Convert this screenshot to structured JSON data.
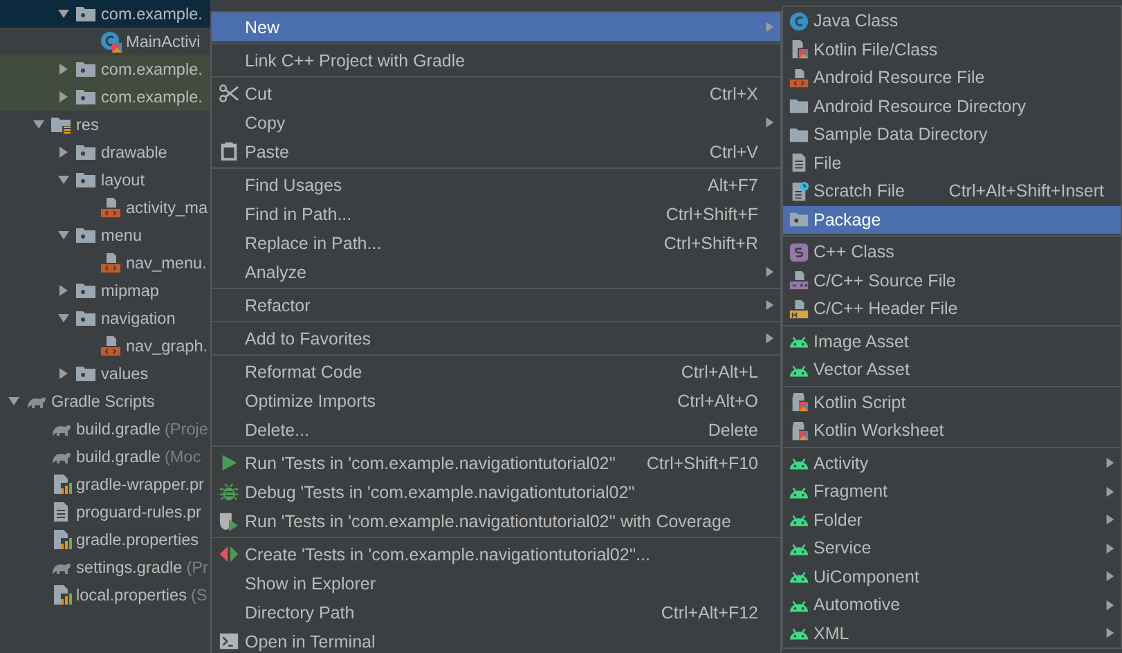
{
  "tree": {
    "items": [
      {
        "children": [
          {
            "children": [
              {
                "label": "com.example.",
                "kind": "package",
                "expanded": true,
                "selected": true,
                "tinted": false,
                "children": [
                  {
                    "label": "MainActivi",
                    "kind": "kotlin-class",
                    "selected": false,
                    "tinted": false
                  }
                ]
              },
              {
                "label": "com.example.",
                "kind": "package",
                "expanded": false,
                "selected": false,
                "tinted": true
              },
              {
                "label": "com.example.",
                "kind": "package",
                "expanded": false,
                "selected": false,
                "tinted": true
              }
            ]
          },
          {
            "label": "res",
            "kind": "res-folder",
            "expanded": true,
            "selected": false,
            "tinted": false,
            "children": [
              {
                "label": "drawable",
                "kind": "package",
                "expanded": false,
                "selected": false,
                "tinted": false
              },
              {
                "label": "layout",
                "kind": "package",
                "expanded": true,
                "selected": false,
                "tinted": false,
                "children": [
                  {
                    "label": "activity_ma",
                    "kind": "resource-file",
                    "selected": false,
                    "tinted": false
                  }
                ]
              },
              {
                "label": "menu",
                "kind": "package",
                "expanded": true,
                "selected": false,
                "tinted": false,
                "children": [
                  {
                    "label": "nav_menu.",
                    "kind": "resource-file",
                    "selected": false,
                    "tinted": false
                  }
                ]
              },
              {
                "label": "mipmap",
                "kind": "package",
                "expanded": false,
                "selected": false,
                "tinted": false
              },
              {
                "label": "navigation",
                "kind": "package",
                "expanded": true,
                "selected": false,
                "tinted": false,
                "children": [
                  {
                    "label": "nav_graph.",
                    "kind": "resource-file",
                    "selected": false,
                    "tinted": false
                  }
                ]
              },
              {
                "label": "values",
                "kind": "package",
                "expanded": false,
                "selected": false,
                "tinted": false
              }
            ]
          }
        ]
      },
      {
        "label": "Gradle Scripts",
        "kind": "gradle",
        "expanded": true,
        "selected": false,
        "tinted": false,
        "children": [
          {
            "label": "build.gradle",
            "note": "(Proje",
            "kind": "gradle",
            "selected": false,
            "tinted": false
          },
          {
            "label": "build.gradle",
            "note": "(Moc",
            "kind": "gradle",
            "selected": false,
            "tinted": false
          },
          {
            "label": "gradle-wrapper.pr",
            "kind": "properties",
            "selected": false,
            "tinted": false
          },
          {
            "label": "proguard-rules.pr",
            "kind": "text-file",
            "selected": false,
            "tinted": false
          },
          {
            "label": "gradle.properties",
            "kind": "properties",
            "selected": false,
            "tinted": false
          },
          {
            "label": "settings.gradle",
            "note": "(Pr",
            "kind": "gradle",
            "selected": false,
            "tinted": false
          },
          {
            "label": "local.properties",
            "note": "(S",
            "kind": "properties",
            "selected": false,
            "tinted": false
          }
        ]
      }
    ]
  },
  "context_menu": {
    "groups": [
      [
        {
          "label": "New",
          "submenu": true,
          "selected": true
        }
      ],
      [
        {
          "label": "Link C++ Project with Gradle",
          "submenu": false,
          "selected": false
        }
      ],
      [
        {
          "label": "Cut",
          "kind": "scissors",
          "shortcut": "Ctrl+X",
          "submenu": false,
          "selected": false
        },
        {
          "label": "Copy",
          "submenu": true,
          "selected": false
        },
        {
          "label": "Paste",
          "kind": "clipboard",
          "shortcut": "Ctrl+V",
          "submenu": false,
          "selected": false
        }
      ],
      [
        {
          "label": "Find Usages",
          "shortcut": "Alt+F7",
          "submenu": false,
          "selected": false
        },
        {
          "label": "Find in Path...",
          "shortcut": "Ctrl+Shift+F",
          "submenu": false,
          "selected": false
        },
        {
          "label": "Replace in Path...",
          "shortcut": "Ctrl+Shift+R",
          "submenu": false,
          "selected": false
        },
        {
          "label": "Analyze",
          "submenu": true,
          "selected": false
        }
      ],
      [
        {
          "label": "Refactor",
          "submenu": true,
          "selected": false
        }
      ],
      [
        {
          "label": "Add to Favorites",
          "submenu": true,
          "selected": false
        }
      ],
      [
        {
          "label": "Reformat Code",
          "shortcut": "Ctrl+Alt+L",
          "submenu": false,
          "selected": false
        },
        {
          "label": "Optimize Imports",
          "shortcut": "Ctrl+Alt+O",
          "submenu": false,
          "selected": false
        },
        {
          "label": "Delete...",
          "shortcut": "Delete",
          "submenu": false,
          "selected": false
        }
      ],
      [
        {
          "label": "Run 'Tests in 'com.example.navigationtutorial02''",
          "kind": "run",
          "shortcut": "Ctrl+Shift+F10",
          "submenu": false,
          "selected": false
        },
        {
          "label": "Debug 'Tests in 'com.example.navigationtutorial02''",
          "kind": "bug",
          "submenu": false,
          "selected": false
        },
        {
          "label": "Run 'Tests in 'com.example.navigationtutorial02'' with Coverage",
          "kind": "coverage",
          "submenu": false,
          "selected": false
        }
      ],
      [
        {
          "label": "Create 'Tests in 'com.example.navigationtutorial02''...",
          "kind": "create-test",
          "submenu": false,
          "selected": false
        },
        {
          "label": "Show in Explorer",
          "submenu": false,
          "selected": false
        },
        {
          "label": "Directory Path",
          "shortcut": "Ctrl+Alt+F12",
          "submenu": false,
          "selected": false
        },
        {
          "label": "Open in Terminal",
          "kind": "terminal",
          "submenu": false,
          "selected": false
        }
      ]
    ]
  },
  "new_submenu": {
    "groups": [
      [
        {
          "label": "Java Class",
          "kind": "java-class",
          "submenu": false,
          "selected": false
        },
        {
          "label": "Kotlin File/Class",
          "kind": "kotlin-file",
          "submenu": false,
          "selected": false
        },
        {
          "label": "Android Resource File",
          "kind": "resource-file",
          "submenu": false,
          "selected": false
        },
        {
          "label": "Android Resource Directory",
          "kind": "folder",
          "submenu": false,
          "selected": false
        },
        {
          "label": "Sample Data Directory",
          "kind": "folder",
          "submenu": false,
          "selected": false
        },
        {
          "label": "File",
          "kind": "text-file",
          "submenu": false,
          "selected": false
        },
        {
          "label": "Scratch File",
          "kind": "scratch-file",
          "shortcut": "Ctrl+Alt+Shift+Insert",
          "submenu": false,
          "selected": false
        },
        {
          "label": "Package",
          "kind": "package",
          "submenu": false,
          "selected": true
        }
      ],
      [
        {
          "label": "C++ Class",
          "kind": "cpp-class",
          "submenu": false,
          "selected": false
        },
        {
          "label": "C/C++ Source File",
          "kind": "cpp-source",
          "submenu": false,
          "selected": false
        },
        {
          "label": "C/C++ Header File",
          "kind": "cpp-header",
          "submenu": false,
          "selected": false
        }
      ],
      [
        {
          "label": "Image Asset",
          "kind": "android",
          "submenu": false,
          "selected": false
        },
        {
          "label": "Vector Asset",
          "kind": "android",
          "submenu": false,
          "selected": false
        }
      ],
      [
        {
          "label": "Kotlin Script",
          "kind": "kotlin-script",
          "submenu": false,
          "selected": false
        },
        {
          "label": "Kotlin Worksheet",
          "kind": "kotlin-script",
          "submenu": false,
          "selected": false
        }
      ],
      [
        {
          "label": "Activity",
          "kind": "android",
          "submenu": true,
          "selected": false
        },
        {
          "label": "Fragment",
          "kind": "android",
          "submenu": true,
          "selected": false
        },
        {
          "label": "Folder",
          "kind": "android",
          "submenu": true,
          "selected": false
        },
        {
          "label": "Service",
          "kind": "android",
          "submenu": true,
          "selected": false
        },
        {
          "label": "UiComponent",
          "kind": "android",
          "submenu": true,
          "selected": false
        },
        {
          "label": "Automotive",
          "kind": "android",
          "submenu": true,
          "selected": false
        },
        {
          "label": "XML",
          "kind": "android",
          "submenu": true,
          "selected": false
        }
      ]
    ]
  }
}
